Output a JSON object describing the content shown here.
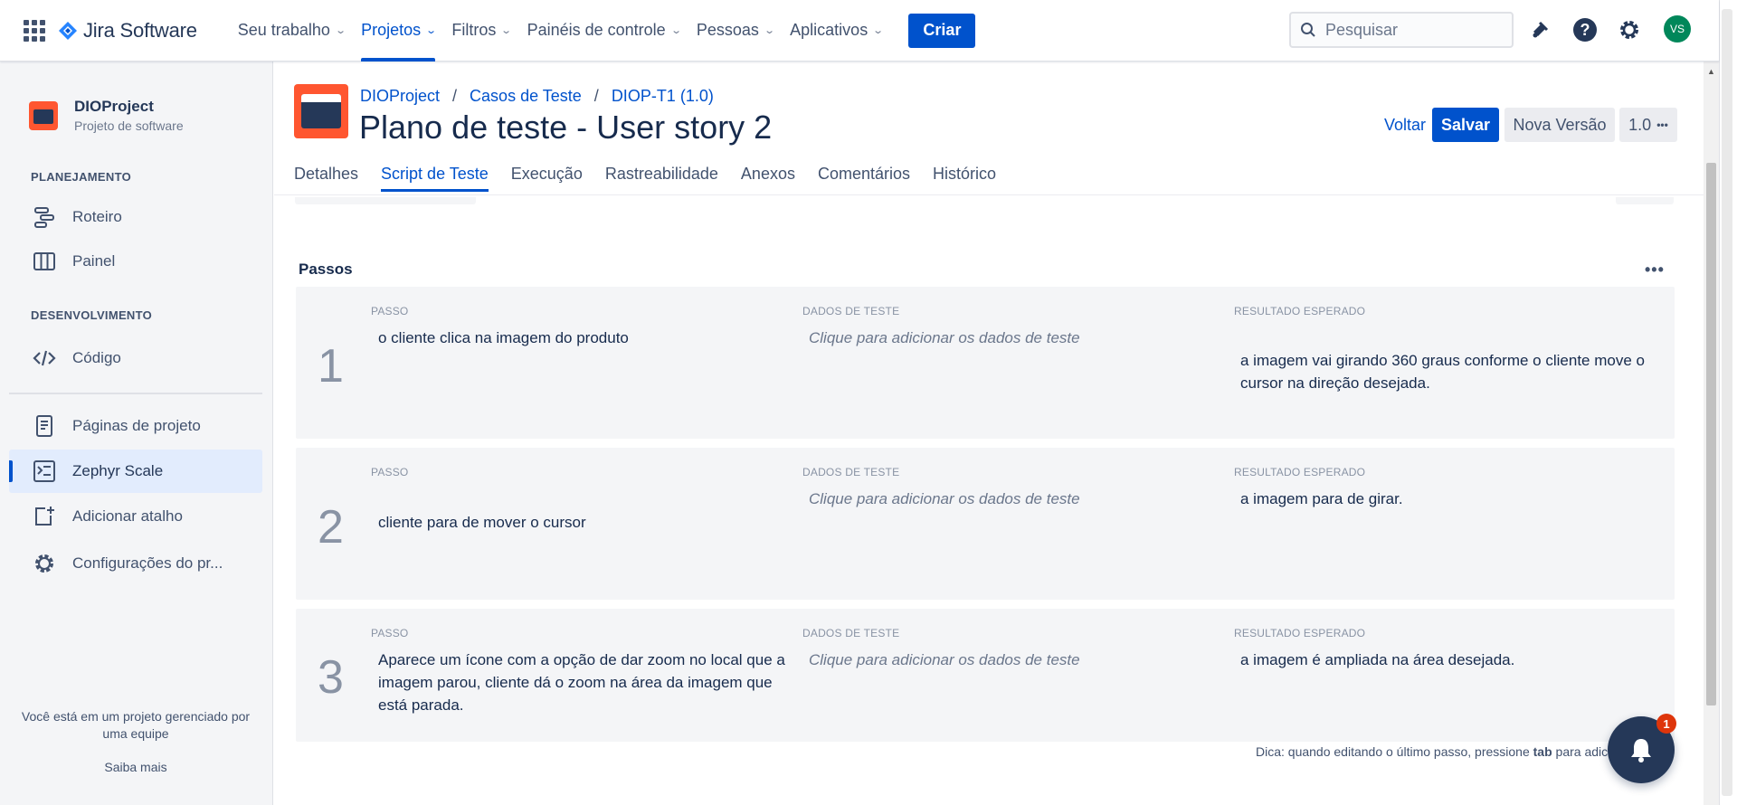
{
  "topnav": {
    "logo": "Jira Software",
    "items": [
      {
        "label": "Seu trabalho"
      },
      {
        "label": "Projetos"
      },
      {
        "label": "Filtros"
      },
      {
        "label": "Painéis de controle"
      },
      {
        "label": "Pessoas"
      },
      {
        "label": "Aplicativos"
      }
    ],
    "create_label": "Criar",
    "search_placeholder": "Pesquisar",
    "avatar_initials": "VS"
  },
  "sidebar": {
    "project_name": "DIOProject",
    "project_type": "Projeto de software",
    "section_planning": "PLANEJAMENTO",
    "planning_items": [
      {
        "label": "Roteiro"
      },
      {
        "label": "Painel"
      }
    ],
    "section_dev": "DESENVOLVIMENTO",
    "dev_items": [
      {
        "label": "Código"
      }
    ],
    "other_items": [
      {
        "label": "Páginas de projeto"
      },
      {
        "label": "Zephyr Scale"
      },
      {
        "label": "Adicionar atalho"
      },
      {
        "label": "Configurações do pr..."
      }
    ],
    "footer_text": "Você está em um projeto gerenciado por uma equipe",
    "footer_link": "Saiba mais"
  },
  "header": {
    "breadcrumbs": [
      "DIOProject",
      "Casos de Teste",
      "DIOP-T1 (1.0)"
    ],
    "title": "Plano de teste - User story 2",
    "back_label": "Voltar",
    "save_label": "Salvar",
    "new_version_label": "Nova Versão",
    "version_label": "1.0",
    "version_more": "•••"
  },
  "tabs": [
    {
      "label": "Detalhes"
    },
    {
      "label": "Script de Teste"
    },
    {
      "label": "Execução"
    },
    {
      "label": "Rastreabilidade"
    },
    {
      "label": "Anexos"
    },
    {
      "label": "Comentários"
    },
    {
      "label": "Histórico"
    }
  ],
  "steps_section": {
    "title": "Passos",
    "more": "•••",
    "col_step": "PASSO",
    "col_data": "DADOS DE TESTE",
    "col_result": "RESULTADO ESPERADO",
    "steps": [
      {
        "number": "1",
        "step": "o cliente clica na imagem do produto",
        "data": "Clique para adicionar os dados de teste",
        "result": "a imagem vai girando 360 graus conforme o cliente move o cursor na direção desejada."
      },
      {
        "number": "2",
        "step": "cliente para de mover o cursor",
        "data": "Clique para adicionar os dados de teste",
        "result": "a imagem para de girar."
      },
      {
        "number": "3",
        "step": "Aparece um ícone com a opção de dar zoom no local que a imagem parou, cliente dá o zoom na área da imagem que está parada.",
        "data": "Clique para adicionar os dados de teste",
        "result": "a imagem é ampliada na área desejada."
      }
    ],
    "tip_prefix": "Dica: quando editando o último passo, pressione ",
    "tip_key": "tab",
    "tip_suffix": " para adicion"
  },
  "notifications": {
    "badge": "1"
  },
  "colors": {
    "primary": "#0052cc",
    "brand_orange": "#ff5630",
    "avatar": "#00875a"
  }
}
